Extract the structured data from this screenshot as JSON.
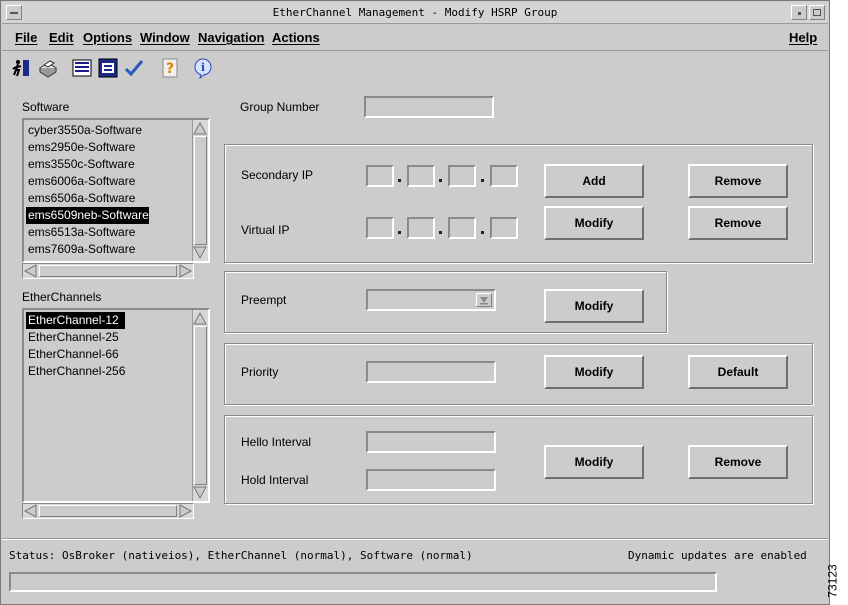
{
  "window": {
    "title": "EtherChannel Management - Modify HSRP Group"
  },
  "menubar": {
    "left": [
      "File",
      "Edit",
      "Options",
      "Window",
      "Navigation",
      "Actions"
    ],
    "help": "Help"
  },
  "toolbar": {
    "icons": [
      "exit-icon",
      "print-icon",
      "list-icon",
      "window-icon",
      "checkmark-icon",
      "help-icon",
      "info-icon"
    ]
  },
  "software": {
    "label": "Software",
    "items": [
      "cyber3550a-Software",
      "ems2950e-Software",
      "ems3550c-Software",
      "ems6006a-Software",
      "ems6506a-Software",
      "ems6509neb-Software",
      "ems6513a-Software",
      "ems7609a-Software"
    ],
    "selected_index": 5
  },
  "etherchannels": {
    "label": "EtherChannels",
    "items": [
      "EtherChannel-12",
      "EtherChannel-25",
      "EtherChannel-66",
      "EtherChannel-256"
    ],
    "selected_index": 0
  },
  "form": {
    "group_number": {
      "label": "Group Number",
      "value": ""
    },
    "secondary_ip": {
      "label": "Secondary IP",
      "add": "Add",
      "remove": "Remove"
    },
    "virtual_ip": {
      "label": "Virtual IP",
      "modify": "Modify",
      "remove": "Remove"
    },
    "preempt": {
      "label": "Preempt",
      "value": "",
      "modify": "Modify"
    },
    "priority": {
      "label": "Priority",
      "value": "",
      "modify": "Modify",
      "default": "Default"
    },
    "hello_interval": {
      "label": "Hello Interval",
      "value": ""
    },
    "hold_interval": {
      "label": "Hold Interval",
      "value": ""
    },
    "interval_modify": "Modify",
    "interval_remove": "Remove"
  },
  "status": {
    "text": "Status: OsBroker (nativeios), EtherChannel (normal), Software (normal)",
    "updates": "Dynamic updates are enabled"
  },
  "figure_number": "73123"
}
